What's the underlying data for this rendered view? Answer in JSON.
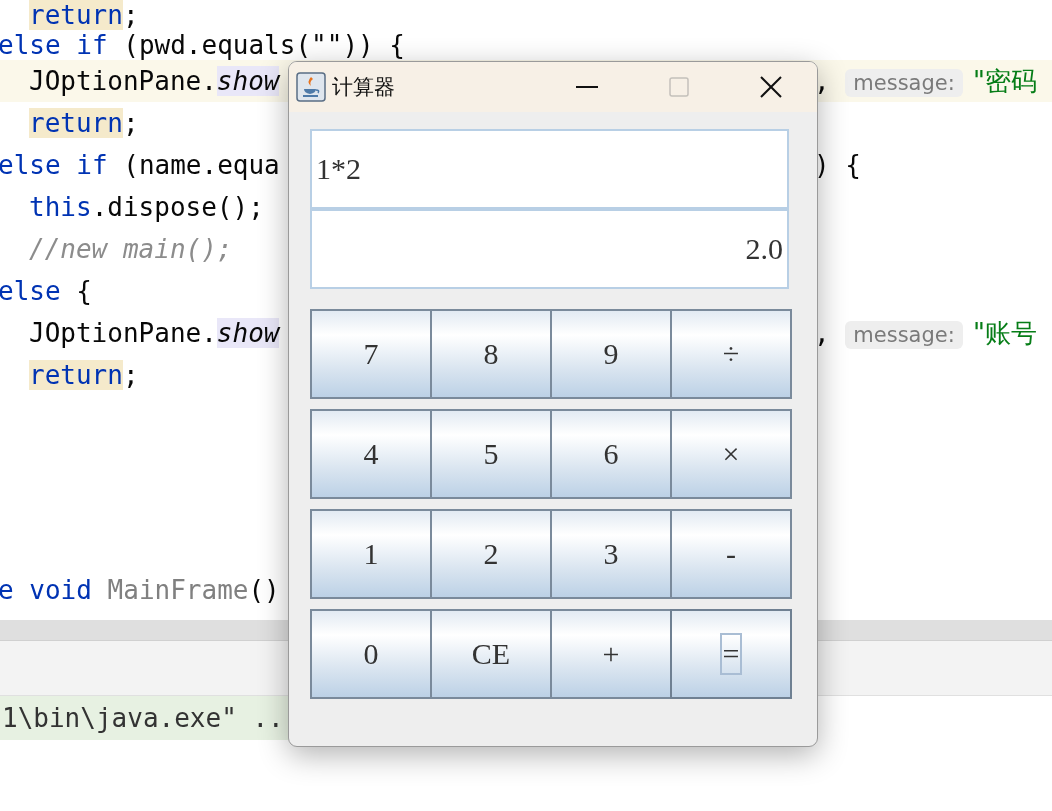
{
  "editor": {
    "lines": [
      {
        "highlighted": false,
        "indented": true,
        "left": [
          {
            "text": "return",
            "kind": "ret"
          },
          {
            "text": ";",
            "kind": "plain"
          }
        ]
      },
      {
        "highlighted": false,
        "indented": false,
        "left": [
          {
            "text": "else if",
            "kind": "kw"
          },
          {
            "text": " (pwd.equals(\"\")) {",
            "kind": "plain"
          }
        ]
      },
      {
        "highlighted": true,
        "indented": true,
        "left": [
          {
            "text": "JOptionPane.",
            "kind": "plain"
          },
          {
            "text": "show",
            "kind": "method"
          }
        ],
        "right": [
          {
            "text": ", ",
            "kind": "plain"
          },
          {
            "text": "message:",
            "kind": "hint"
          },
          {
            "text": " \"密码",
            "kind": "str"
          }
        ]
      },
      {
        "highlighted": false,
        "indented": true,
        "left": [
          {
            "text": "return",
            "kind": "ret"
          },
          {
            "text": ";",
            "kind": "plain"
          }
        ]
      },
      {
        "highlighted": false,
        "indented": false,
        "left": [
          {
            "text": "else if",
            "kind": "kw"
          },
          {
            "text": " (name.equa",
            "kind": "plain"
          }
        ],
        "right": [
          {
            "text": ") {",
            "kind": "plain"
          }
        ]
      },
      {
        "highlighted": false,
        "indented": true,
        "left": [
          {
            "text": "this",
            "kind": "kw"
          },
          {
            "text": ".dispose();",
            "kind": "plain"
          }
        ]
      },
      {
        "highlighted": false,
        "indented": true,
        "left": [
          {
            "text": "//new main();",
            "kind": "comment"
          }
        ]
      },
      {
        "highlighted": false,
        "indented": false,
        "left": [
          {
            "text": "else",
            "kind": "kw"
          },
          {
            "text": " {",
            "kind": "plain"
          }
        ]
      },
      {
        "highlighted": false,
        "indented": true,
        "left": [
          {
            "text": "JOptionPane.",
            "kind": "plain"
          },
          {
            "text": "show",
            "kind": "method"
          }
        ],
        "right": [
          {
            "text": ", ",
            "kind": "plain"
          },
          {
            "text": "message:",
            "kind": "hint"
          },
          {
            "text": " \"账号",
            "kind": "str"
          }
        ]
      },
      {
        "highlighted": false,
        "indented": true,
        "left": [
          {
            "text": "return",
            "kind": "ret"
          },
          {
            "text": ";",
            "kind": "plain"
          }
        ]
      },
      {
        "highlighted": false,
        "indented": false,
        "left": [
          {
            "text": "e void",
            "kind": "kw"
          },
          {
            "text": " MainFrame",
            "kind": "decl"
          },
          {
            "text": "()",
            "kind": "plain"
          }
        ]
      }
    ]
  },
  "console": {
    "line": "1\\bin\\java.exe\" .."
  },
  "window": {
    "title": "计算器",
    "maximize_disabled": true,
    "expression": "1*2",
    "result": "2.0",
    "buttons": [
      {
        "label": "7",
        "focused": false
      },
      {
        "label": "8",
        "focused": false
      },
      {
        "label": "9",
        "focused": false
      },
      {
        "label": "÷",
        "focused": false
      },
      {
        "label": "4",
        "focused": false
      },
      {
        "label": "5",
        "focused": false
      },
      {
        "label": "6",
        "focused": false
      },
      {
        "label": "×",
        "focused": false
      },
      {
        "label": "1",
        "focused": false
      },
      {
        "label": "2",
        "focused": false
      },
      {
        "label": "3",
        "focused": false
      },
      {
        "label": "-",
        "focused": false
      },
      {
        "label": "0",
        "focused": false
      },
      {
        "label": "CE",
        "focused": false
      },
      {
        "label": "+",
        "focused": false
      },
      {
        "label": "=",
        "focused": true
      }
    ]
  }
}
